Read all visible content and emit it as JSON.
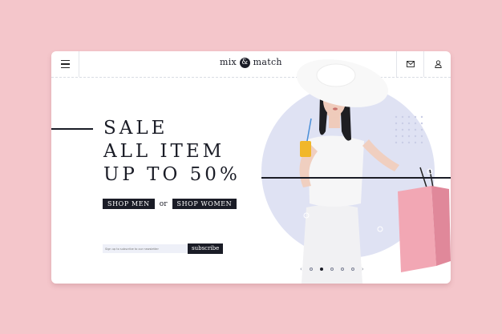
{
  "header": {
    "logo_left": "mix",
    "logo_amp": "&",
    "logo_right": "match",
    "icons": [
      "menu-icon",
      "mail-icon",
      "user-icon"
    ]
  },
  "hero": {
    "headline": [
      "SALE",
      "ALL ITEM",
      "UP TO 50%"
    ],
    "shop_men": "SHOP MEN",
    "or": "or",
    "shop_women": "SHOP WOMEN"
  },
  "newsletter": {
    "placeholder": "Sign up to subscribe to our newsletter",
    "button": "subscribe"
  },
  "carousel": {
    "prev": "‹",
    "next": "›",
    "slide_count": 5,
    "active_index": 0
  },
  "colors": {
    "background": "#f4c6cb",
    "ink": "#1a1c26",
    "accent_circle": "#dfe2f3",
    "bag": "#f2a7b4"
  }
}
